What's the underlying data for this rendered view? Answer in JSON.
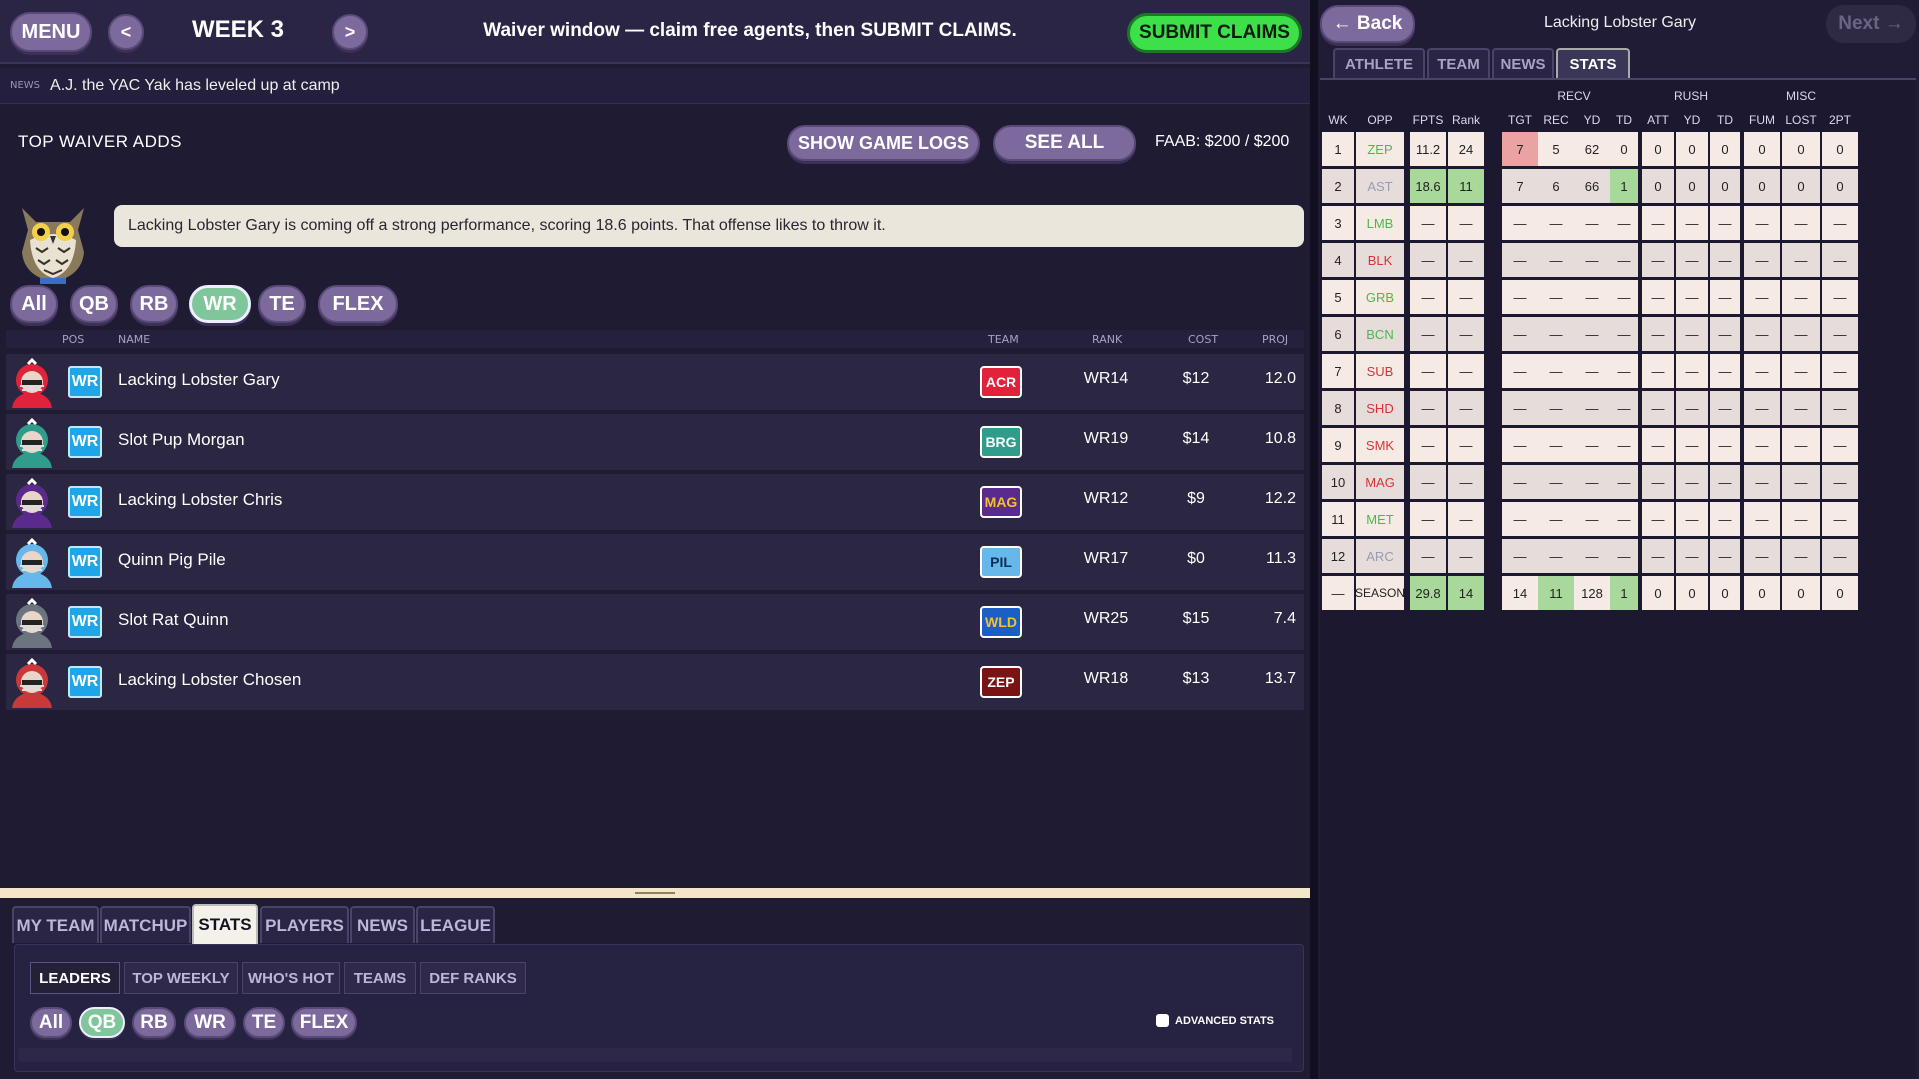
{
  "topbar": {
    "menu_label": "MENU",
    "prev_label": "<",
    "next_label": ">",
    "week_label": "WEEK 3",
    "message": "Waiver window — claim free agents, then SUBMIT CLAIMS.",
    "submit_label": "SUBMIT CLAIMS"
  },
  "news": {
    "tag": "NEWS",
    "text": "A.J. the YAC Yak has leveled up at camp"
  },
  "waivers": {
    "title": "TOP WAIVER ADDS",
    "game_logs_label": "SHOW GAME LOGS",
    "see_all_label": "SEE ALL",
    "faab": "FAAB: $200 / $200",
    "advice": "Lacking Lobster Gary is coming off a strong performance, scoring 18.6 points. That offense likes to throw it.",
    "filters": [
      "All",
      "QB",
      "RB",
      "WR",
      "TE",
      "FLEX"
    ],
    "active_filter": "WR",
    "columns": {
      "pos": "POS",
      "name": "NAME",
      "team": "TEAM",
      "rank": "RANK",
      "cost": "COST",
      "proj": "PROJ"
    },
    "players": [
      {
        "pos": "WR",
        "name": "Lacking Lobster Gary",
        "team": "ACR",
        "rank": "WR14",
        "cost": "$12",
        "proj": "12.0",
        "team_color": "#e0223a",
        "team_text": "#ffffff",
        "helmet": "#e0223a"
      },
      {
        "pos": "WR",
        "name": "Slot Pup Morgan",
        "team": "BRG",
        "rank": "WR19",
        "cost": "$14",
        "proj": "10.8",
        "team_color": "#2f9c8c",
        "team_text": "#ffffff",
        "helmet": "#2f9c8c"
      },
      {
        "pos": "WR",
        "name": "Lacking Lobster Chris",
        "team": "MAG",
        "rank": "WR12",
        "cost": "$9",
        "proj": "12.2",
        "team_color": "#5a2a8c",
        "team_text": "#f2c230",
        "helmet": "#5a2a8c"
      },
      {
        "pos": "WR",
        "name": "Quinn Pig Pile",
        "team": "PIL",
        "rank": "WR17",
        "cost": "$0",
        "proj": "11.3",
        "team_color": "#66b8ea",
        "team_text": "#0c2f5a",
        "helmet": "#66b8ea"
      },
      {
        "pos": "WR",
        "name": "Slot Rat Quinn",
        "team": "WLD",
        "rank": "WR25",
        "cost": "$15",
        "proj": "7.4",
        "team_color": "#1b5fc4",
        "team_text": "#f2c230",
        "helmet": "#6c7480"
      },
      {
        "pos": "WR",
        "name": "Lacking Lobster Chosen",
        "team": "ZEP",
        "rank": "WR18",
        "cost": "$13",
        "proj": "13.7",
        "team_color": "#7a1414",
        "team_text": "#ffffff",
        "helmet": "#c83a3a"
      }
    ]
  },
  "bottom": {
    "tabs": [
      "MY TEAM",
      "MATCHUP",
      "STATS",
      "PLAYERS",
      "NEWS",
      "LEAGUE"
    ],
    "active_tab": "STATS",
    "subtabs": [
      "LEADERS",
      "TOP WEEKLY",
      "WHO'S HOT",
      "TEAMS",
      "DEF RANKS"
    ],
    "active_subtab": "LEADERS",
    "filters": [
      "All",
      "QB",
      "RB",
      "WR",
      "TE",
      "FLEX"
    ],
    "active_filter": "QB",
    "advanced_label": "ADVANCED STATS"
  },
  "player_panel": {
    "back_label": "← Back",
    "next_label": "Next →",
    "title": "Lacking Lobster Gary",
    "tabs": [
      "ATHLETE",
      "TEAM",
      "NEWS",
      "STATS"
    ],
    "active_tab": "STATS",
    "groups": [
      "RECV",
      "RUSH",
      "MISC"
    ],
    "columns": [
      "WK",
      "OPP",
      "FPTS",
      "Rank",
      "TGT",
      "REC",
      "YD",
      "TD",
      "ATT",
      "YD",
      "TD",
      "FUM",
      "LOST",
      "2PT"
    ],
    "rows": [
      {
        "wk": "1",
        "opp": "ZEP",
        "opp_color": "#4bb84b",
        "vals": [
          "11.2",
          "24",
          "7",
          "5",
          "62",
          "0",
          "0",
          "0",
          "0",
          "0",
          "0",
          "0"
        ]
      },
      {
        "wk": "2",
        "opp": "AST",
        "opp_color": "#9a9ab4",
        "vals": [
          "18.6",
          "11",
          "7",
          "6",
          "66",
          "1",
          "0",
          "0",
          "0",
          "0",
          "0",
          "0"
        ]
      },
      {
        "wk": "3",
        "opp": "LMB",
        "opp_color": "#4bb84b",
        "vals": [
          "—",
          "—",
          "—",
          "—",
          "—",
          "—",
          "—",
          "—",
          "—",
          "—",
          "—",
          "—"
        ]
      },
      {
        "wk": "4",
        "opp": "BLK",
        "opp_color": "#d6333a",
        "vals": [
          "—",
          "—",
          "—",
          "—",
          "—",
          "—",
          "—",
          "—",
          "—",
          "—",
          "—",
          "—"
        ]
      },
      {
        "wk": "5",
        "opp": "GRB",
        "opp_color": "#4bb84b",
        "vals": [
          "—",
          "—",
          "—",
          "—",
          "—",
          "—",
          "—",
          "—",
          "—",
          "—",
          "—",
          "—"
        ]
      },
      {
        "wk": "6",
        "opp": "BCN",
        "opp_color": "#4bb84b",
        "vals": [
          "—",
          "—",
          "—",
          "—",
          "—",
          "—",
          "—",
          "—",
          "—",
          "—",
          "—",
          "—"
        ]
      },
      {
        "wk": "7",
        "opp": "SUB",
        "opp_color": "#d6333a",
        "vals": [
          "—",
          "—",
          "—",
          "—",
          "—",
          "—",
          "—",
          "—",
          "—",
          "—",
          "—",
          "—"
        ]
      },
      {
        "wk": "8",
        "opp": "SHD",
        "opp_color": "#d6333a",
        "vals": [
          "—",
          "—",
          "—",
          "—",
          "—",
          "—",
          "—",
          "—",
          "—",
          "—",
          "—",
          "—"
        ]
      },
      {
        "wk": "9",
        "opp": "SMK",
        "opp_color": "#d6333a",
        "vals": [
          "—",
          "—",
          "—",
          "—",
          "—",
          "—",
          "—",
          "—",
          "—",
          "—",
          "—",
          "—"
        ]
      },
      {
        "wk": "10",
        "opp": "MAG",
        "opp_color": "#d6333a",
        "vals": [
          "—",
          "—",
          "—",
          "—",
          "—",
          "—",
          "—",
          "—",
          "—",
          "—",
          "—",
          "—"
        ]
      },
      {
        "wk": "11",
        "opp": "MET",
        "opp_color": "#4bb84b",
        "vals": [
          "—",
          "—",
          "—",
          "—",
          "—",
          "—",
          "—",
          "—",
          "—",
          "—",
          "—",
          "—"
        ]
      },
      {
        "wk": "12",
        "opp": "ARC",
        "opp_color": "#9a9ab4",
        "vals": [
          "—",
          "—",
          "—",
          "—",
          "—",
          "—",
          "—",
          "—",
          "—",
          "—",
          "—",
          "—"
        ]
      },
      {
        "wk": "—",
        "opp": "SEASON",
        "opp_color": "#222222",
        "vals": [
          "29.8",
          "14",
          "14",
          "11",
          "128",
          "1",
          "0",
          "0",
          "0",
          "0",
          "0",
          "0"
        ]
      }
    ],
    "highlight_good": "#a8d89a",
    "highlight_bad": "#eaa2a2"
  }
}
